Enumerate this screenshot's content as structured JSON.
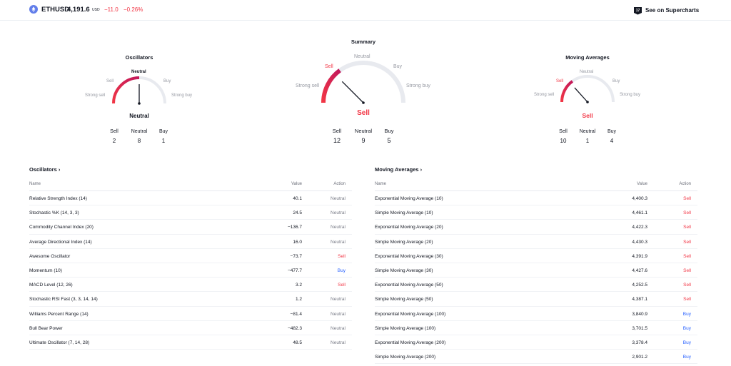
{
  "header": {
    "symbol": "ETHUSD",
    "price": "4,191.6",
    "currency": "USD",
    "change": "−11.0",
    "change_percent": "−0.26%",
    "supercharts_label": "See on Supercharts",
    "icon_names": [
      "ethereum-icon",
      "supercharts-icon"
    ]
  },
  "colors": {
    "sell": "#f23645",
    "buy": "#2962ff",
    "neutral": "#787b86",
    "track": "#e8eaef"
  },
  "gauges": {
    "labels": {
      "strong_sell": "Strong sell",
      "sell": "Sell",
      "neutral": "Neutral",
      "buy": "Buy",
      "strong_buy": "Strong buy"
    },
    "oscillators": {
      "title": "Oscillators",
      "result": "Neutral",
      "counts": {
        "sell_label": "Sell",
        "sell": "2",
        "neutral_label": "Neutral",
        "neutral": "8",
        "buy_label": "Buy",
        "buy": "1"
      }
    },
    "summary": {
      "title": "Summary",
      "result": "Sell",
      "counts": {
        "sell_label": "Sell",
        "sell": "12",
        "neutral_label": "Neutral",
        "neutral": "9",
        "buy_label": "Buy",
        "buy": "5"
      }
    },
    "moving_averages": {
      "title": "Moving Averages",
      "result": "Sell",
      "counts": {
        "sell_label": "Sell",
        "sell": "10",
        "neutral_label": "Neutral",
        "neutral": "1",
        "buy_label": "Buy",
        "buy": "4"
      }
    }
  },
  "oscillators_table": {
    "title": "Oscillators ›",
    "columns": {
      "name": "Name",
      "value": "Value",
      "action": "Action"
    },
    "rows": [
      {
        "name": "Relative Strength Index (14)",
        "value": "40.1",
        "action": "Neutral"
      },
      {
        "name": "Stochastic %K (14, 3, 3)",
        "value": "24.5",
        "action": "Neutral"
      },
      {
        "name": "Commodity Channel Index (20)",
        "value": "−136.7",
        "action": "Neutral"
      },
      {
        "name": "Average Directional Index (14)",
        "value": "16.0",
        "action": "Neutral"
      },
      {
        "name": "Awesome Oscillator",
        "value": "−73.7",
        "action": "Sell"
      },
      {
        "name": "Momentum (10)",
        "value": "−477.7",
        "action": "Buy"
      },
      {
        "name": "MACD Level (12, 26)",
        "value": "3.2",
        "action": "Sell"
      },
      {
        "name": "Stochastic RSI Fast (3, 3, 14, 14)",
        "value": "1.2",
        "action": "Neutral"
      },
      {
        "name": "Williams Percent Range (14)",
        "value": "−81.4",
        "action": "Neutral"
      },
      {
        "name": "Bull Bear Power",
        "value": "−482.3",
        "action": "Neutral"
      },
      {
        "name": "Ultimate Oscillator (7, 14, 28)",
        "value": "48.5",
        "action": "Neutral"
      }
    ]
  },
  "moving_averages_table": {
    "title": "Moving Averages ›",
    "columns": {
      "name": "Name",
      "value": "Value",
      "action": "Action"
    },
    "rows": [
      {
        "name": "Exponential Moving Average (10)",
        "value": "4,400.3",
        "action": "Sell"
      },
      {
        "name": "Simple Moving Average (10)",
        "value": "4,461.1",
        "action": "Sell"
      },
      {
        "name": "Exponential Moving Average (20)",
        "value": "4,422.3",
        "action": "Sell"
      },
      {
        "name": "Simple Moving Average (20)",
        "value": "4,430.3",
        "action": "Sell"
      },
      {
        "name": "Exponential Moving Average (30)",
        "value": "4,391.9",
        "action": "Sell"
      },
      {
        "name": "Simple Moving Average (30)",
        "value": "4,427.6",
        "action": "Sell"
      },
      {
        "name": "Exponential Moving Average (50)",
        "value": "4,252.5",
        "action": "Sell"
      },
      {
        "name": "Simple Moving Average (50)",
        "value": "4,387.1",
        "action": "Sell"
      },
      {
        "name": "Exponential Moving Average (100)",
        "value": "3,840.9",
        "action": "Buy"
      },
      {
        "name": "Simple Moving Average (100)",
        "value": "3,701.5",
        "action": "Buy"
      },
      {
        "name": "Exponential Moving Average (200)",
        "value": "3,378.4",
        "action": "Buy"
      },
      {
        "name": "Simple Moving Average (200)",
        "value": "2,901.2",
        "action": "Buy"
      }
    ]
  }
}
